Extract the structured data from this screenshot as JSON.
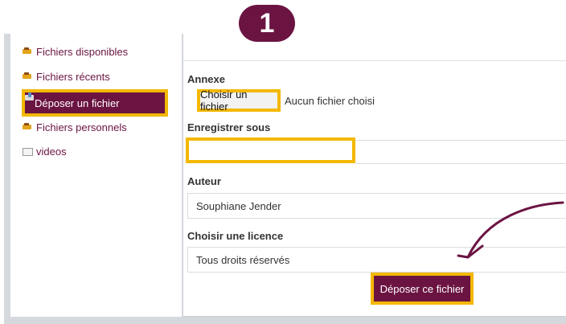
{
  "step": {
    "number": "1"
  },
  "sidebar": {
    "items": [
      {
        "label": "Fichiers disponibles",
        "icon": "folder-icon"
      },
      {
        "label": "Fichiers récents",
        "icon": "folder-icon"
      },
      {
        "label": "Déposer un fichier",
        "icon": "upload-icon",
        "active": true
      },
      {
        "label": "Fichiers personnels",
        "icon": "folder-icon"
      },
      {
        "label": "videos",
        "icon": "video-icon"
      }
    ]
  },
  "form": {
    "annexe_label": "Annexe",
    "choose_file_button": "Choisir un fichier",
    "file_status": "Aucun fichier choisi",
    "save_as_label": "Enregistrer sous",
    "save_as_value": "",
    "author_label": "Auteur",
    "author_value": "Souphiane Jender",
    "license_label": "Choisir une licence",
    "license_value": "Tous droits réservés",
    "submit_button": "Déposer ce fichier"
  },
  "colors": {
    "brand": "#6b1442",
    "highlight": "#f3b800",
    "frame": "#d5d9de"
  }
}
